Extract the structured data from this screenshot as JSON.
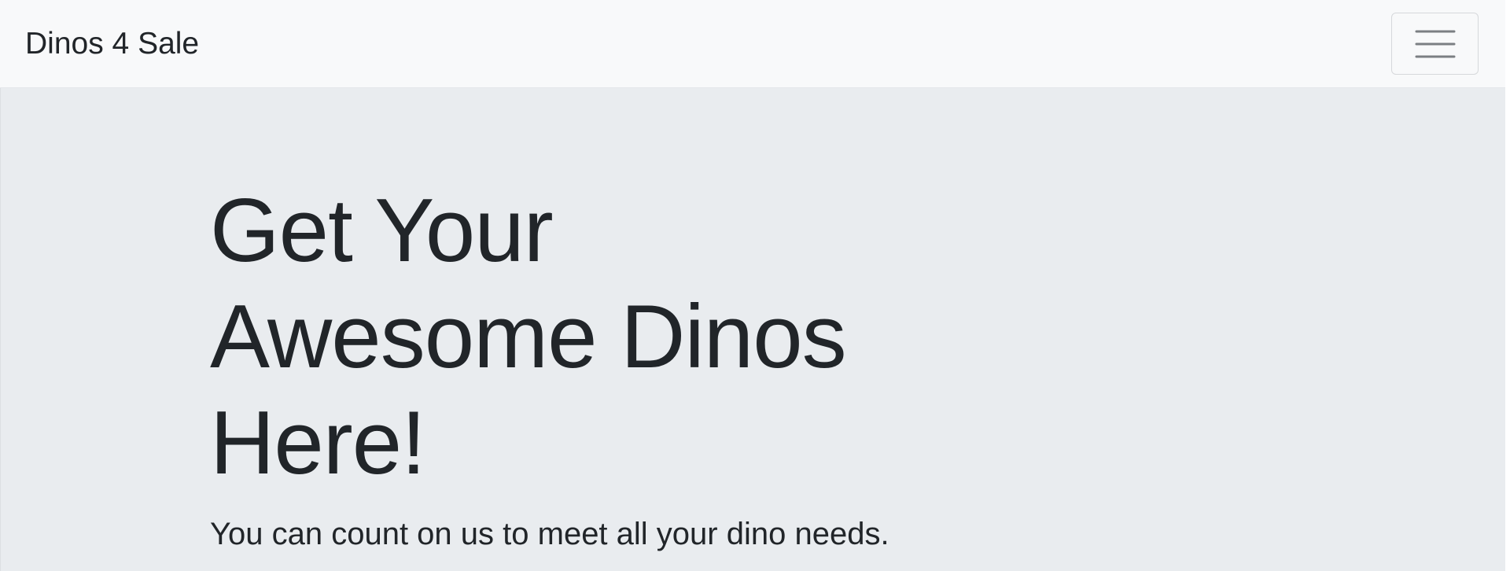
{
  "navbar": {
    "brand": "Dinos 4 Sale",
    "toggler_icon": "hamburger-menu-icon"
  },
  "hero": {
    "title": "Get Your Awesome Dinos Here!",
    "lead": "You can count on us to meet all your dino needs."
  },
  "colors": {
    "navbar_background": "#f8f9fa",
    "hero_background": "#e9ecef",
    "text": "#212529",
    "toggler_border": "#d6d8db",
    "icon": "#7b7f83"
  }
}
